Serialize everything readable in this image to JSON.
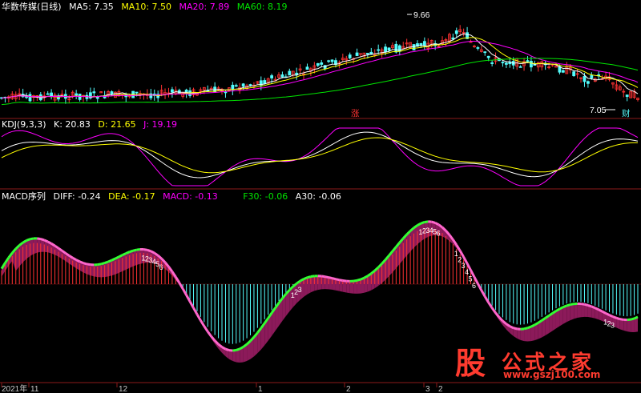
{
  "main_panel": {
    "stock_name": "华数传媒(日线)",
    "ma5": "MA5: 7.35",
    "ma10": "MA10: 7.50",
    "ma20": "MA20: 7.89",
    "ma60": "MA60: 8.19",
    "high_price": "9.66",
    "low_price": "7.05",
    "marker_zhang": "涨",
    "marker_cai": "财"
  },
  "kdj_panel": {
    "name": "KDJ(9,3,3)",
    "k": "K: 20.83",
    "d": "D: 21.65",
    "j": "J: 19.19"
  },
  "macd_panel": {
    "name": "MACD序列",
    "diff": "DIFF: -0.24",
    "dea": "DEA: -0.17",
    "macd": "MACD: -0.13",
    "f30": "F30: -0.06",
    "a30": "A30: -0.06",
    "seq_groups": [
      {
        "digits": [
          "1",
          "2",
          "3",
          "4",
          "5",
          "6"
        ],
        "color": "#ffffff"
      },
      {
        "digits": [
          "1",
          "2",
          "3"
        ],
        "color": "#ffffff"
      },
      {
        "digits": [
          "1",
          "2",
          "3",
          "4",
          "5",
          "6"
        ],
        "color": "#ffffff"
      },
      {
        "digits": [
          "1",
          "2",
          "3",
          "4",
          "5",
          "6"
        ],
        "color": "#ffffff"
      },
      {
        "digits": [
          "1",
          "2",
          "3"
        ],
        "color": "#ffffff"
      }
    ]
  },
  "time_axis": {
    "labels": [
      "2021年",
      "11",
      "12",
      "1",
      "2",
      "3",
      "2"
    ]
  },
  "colors": {
    "up": "#ff3232",
    "down": "#54fcfc",
    "ma5": "#ffffff",
    "ma10": "#ffff00",
    "ma20": "#ff00ff",
    "ma60": "#00e600",
    "k": "#ffffff",
    "d": "#ffff00",
    "j": "#ff00ff",
    "diff_up": "#ff66cc",
    "diff_down": "#33ff33",
    "band_purple": "#8c1a5a",
    "band_cyan": "#1a6b8c",
    "divider": "#8b1a1a"
  },
  "watermark": {
    "icon_char": "股",
    "site_name": "公式之家",
    "url": "www.gszj100.com"
  }
}
